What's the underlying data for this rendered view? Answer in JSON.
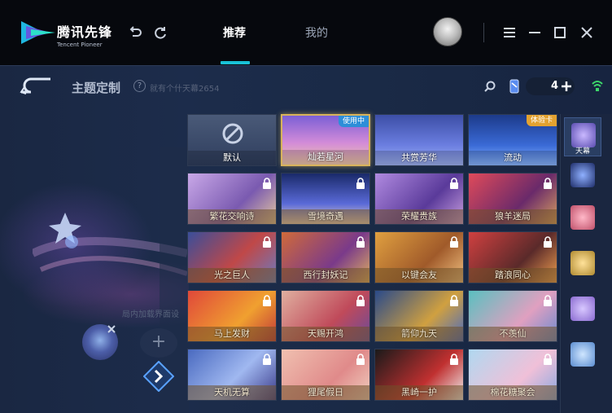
{
  "app": {
    "brand_cn": "腾讯先锋",
    "brand_en": "Tencent Pioneer"
  },
  "nav": {
    "tabs": [
      {
        "label": "推荐",
        "active": true
      },
      {
        "label": "我的",
        "active": false
      }
    ]
  },
  "header": {
    "title": "主题定制",
    "help": "?",
    "subtitle": "就有个什天幕2654",
    "count": "4"
  },
  "preview": {
    "ghost_text": "局内加载界面设",
    "add": "+"
  },
  "themes": [
    {
      "label": "默认",
      "locked": false,
      "selected": false,
      "badge": ""
    },
    {
      "label": "灿若星河",
      "locked": false,
      "selected": true,
      "badge": "使用中"
    },
    {
      "label": "共赏芳华",
      "locked": false,
      "selected": false,
      "badge": ""
    },
    {
      "label": "流动",
      "locked": false,
      "selected": false,
      "badge": "体验卡"
    },
    {
      "label": "繁花交响诗",
      "locked": true
    },
    {
      "label": "雪境奇遇",
      "locked": true
    },
    {
      "label": "荣耀贵族",
      "locked": true
    },
    {
      "label": "狼羊迷局",
      "locked": true
    },
    {
      "label": "光之巨人",
      "locked": true
    },
    {
      "label": "西行封妖记",
      "locked": true
    },
    {
      "label": "以键会友",
      "locked": true
    },
    {
      "label": "踏浪同心",
      "locked": true
    },
    {
      "label": "马上发财",
      "locked": true
    },
    {
      "label": "天赐开鸿",
      "locked": true
    },
    {
      "label": "箭仰九天",
      "locked": true
    },
    {
      "label": "不羡仙",
      "locked": true
    },
    {
      "label": "天机无算",
      "locked": true
    },
    {
      "label": "狸尾假日",
      "locked": true
    },
    {
      "label": "黑崎一护",
      "locked": true
    },
    {
      "label": "棉花糖聚会",
      "locked": true
    }
  ],
  "sidebar": {
    "items": [
      {
        "label": "天幕",
        "active": true
      }
    ]
  },
  "colors": {
    "accent": "#19c1d6",
    "selected_border": "#d8b35c",
    "inuse_badge": "#2d8ed8",
    "trial_badge": "#e3a230"
  }
}
